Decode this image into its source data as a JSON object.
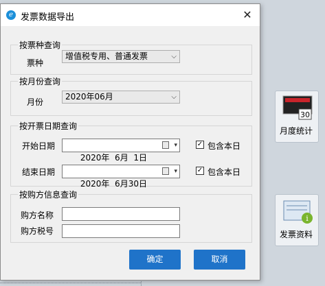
{
  "dialog": {
    "title": "发票数据导出",
    "close_glyph": "✕",
    "app_icon_glyph": "ℯ"
  },
  "groups": {
    "invoice_type": {
      "title": "按票种查询",
      "label": "票种",
      "selected": "增值税专用、普通发票"
    },
    "month": {
      "title": "按月份查询",
      "label": "月份",
      "selected": "2020年06月"
    },
    "date": {
      "title": "按开票日期查询",
      "start_label": "开始日期",
      "start_value": "2020年  6月  1日",
      "start_include": "包含本日",
      "end_label": "结束日期",
      "end_value": "2020年  6月30日",
      "end_include": "包含本日"
    },
    "buyer": {
      "title": "按购方信息查询",
      "name_label": "购方名称",
      "name_value": "",
      "tax_label": "购方税号",
      "tax_value": ""
    }
  },
  "buttons": {
    "confirm": "确定",
    "cancel": "取消"
  },
  "background": {
    "tile_month": {
      "label": "月度统计",
      "badge": "30"
    },
    "tile_invoice": {
      "label": "发票资料"
    }
  },
  "icons": {
    "dropdown": "chevron-down-icon",
    "calendar": "calendar-icon",
    "check": "✓"
  },
  "colors": {
    "button_bg": "#1f73c9",
    "dialog_bg": "#f0f0f0"
  }
}
